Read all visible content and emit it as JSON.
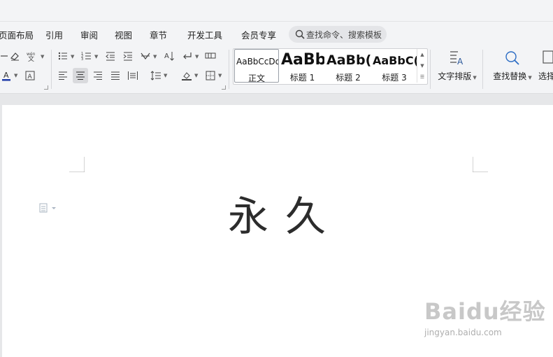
{
  "menu": {
    "items": [
      "页面布局",
      "引用",
      "审阅",
      "视图",
      "章节",
      "开发工具",
      "会员专享"
    ],
    "search_placeholder": "查找命令、搜索模板"
  },
  "ribbon": {
    "styles": [
      {
        "preview": "AaBbCcDd",
        "label": "正文"
      },
      {
        "preview": "AaBb",
        "label": "标题 1"
      },
      {
        "preview": "AaBb(",
        "label": "标题 2"
      },
      {
        "preview": "AaBbC(",
        "label": "标题 3"
      }
    ],
    "text_layout_label": "文字排版",
    "find_replace_label": "查找替换",
    "select_label": "选择"
  },
  "document": {
    "text": "永久"
  },
  "watermark": {
    "big": "Baidu经验",
    "small": "jingyan.baidu.com"
  },
  "colors": {
    "accent": "#2b579a",
    "font_color_bar": "#1f3ba8"
  }
}
